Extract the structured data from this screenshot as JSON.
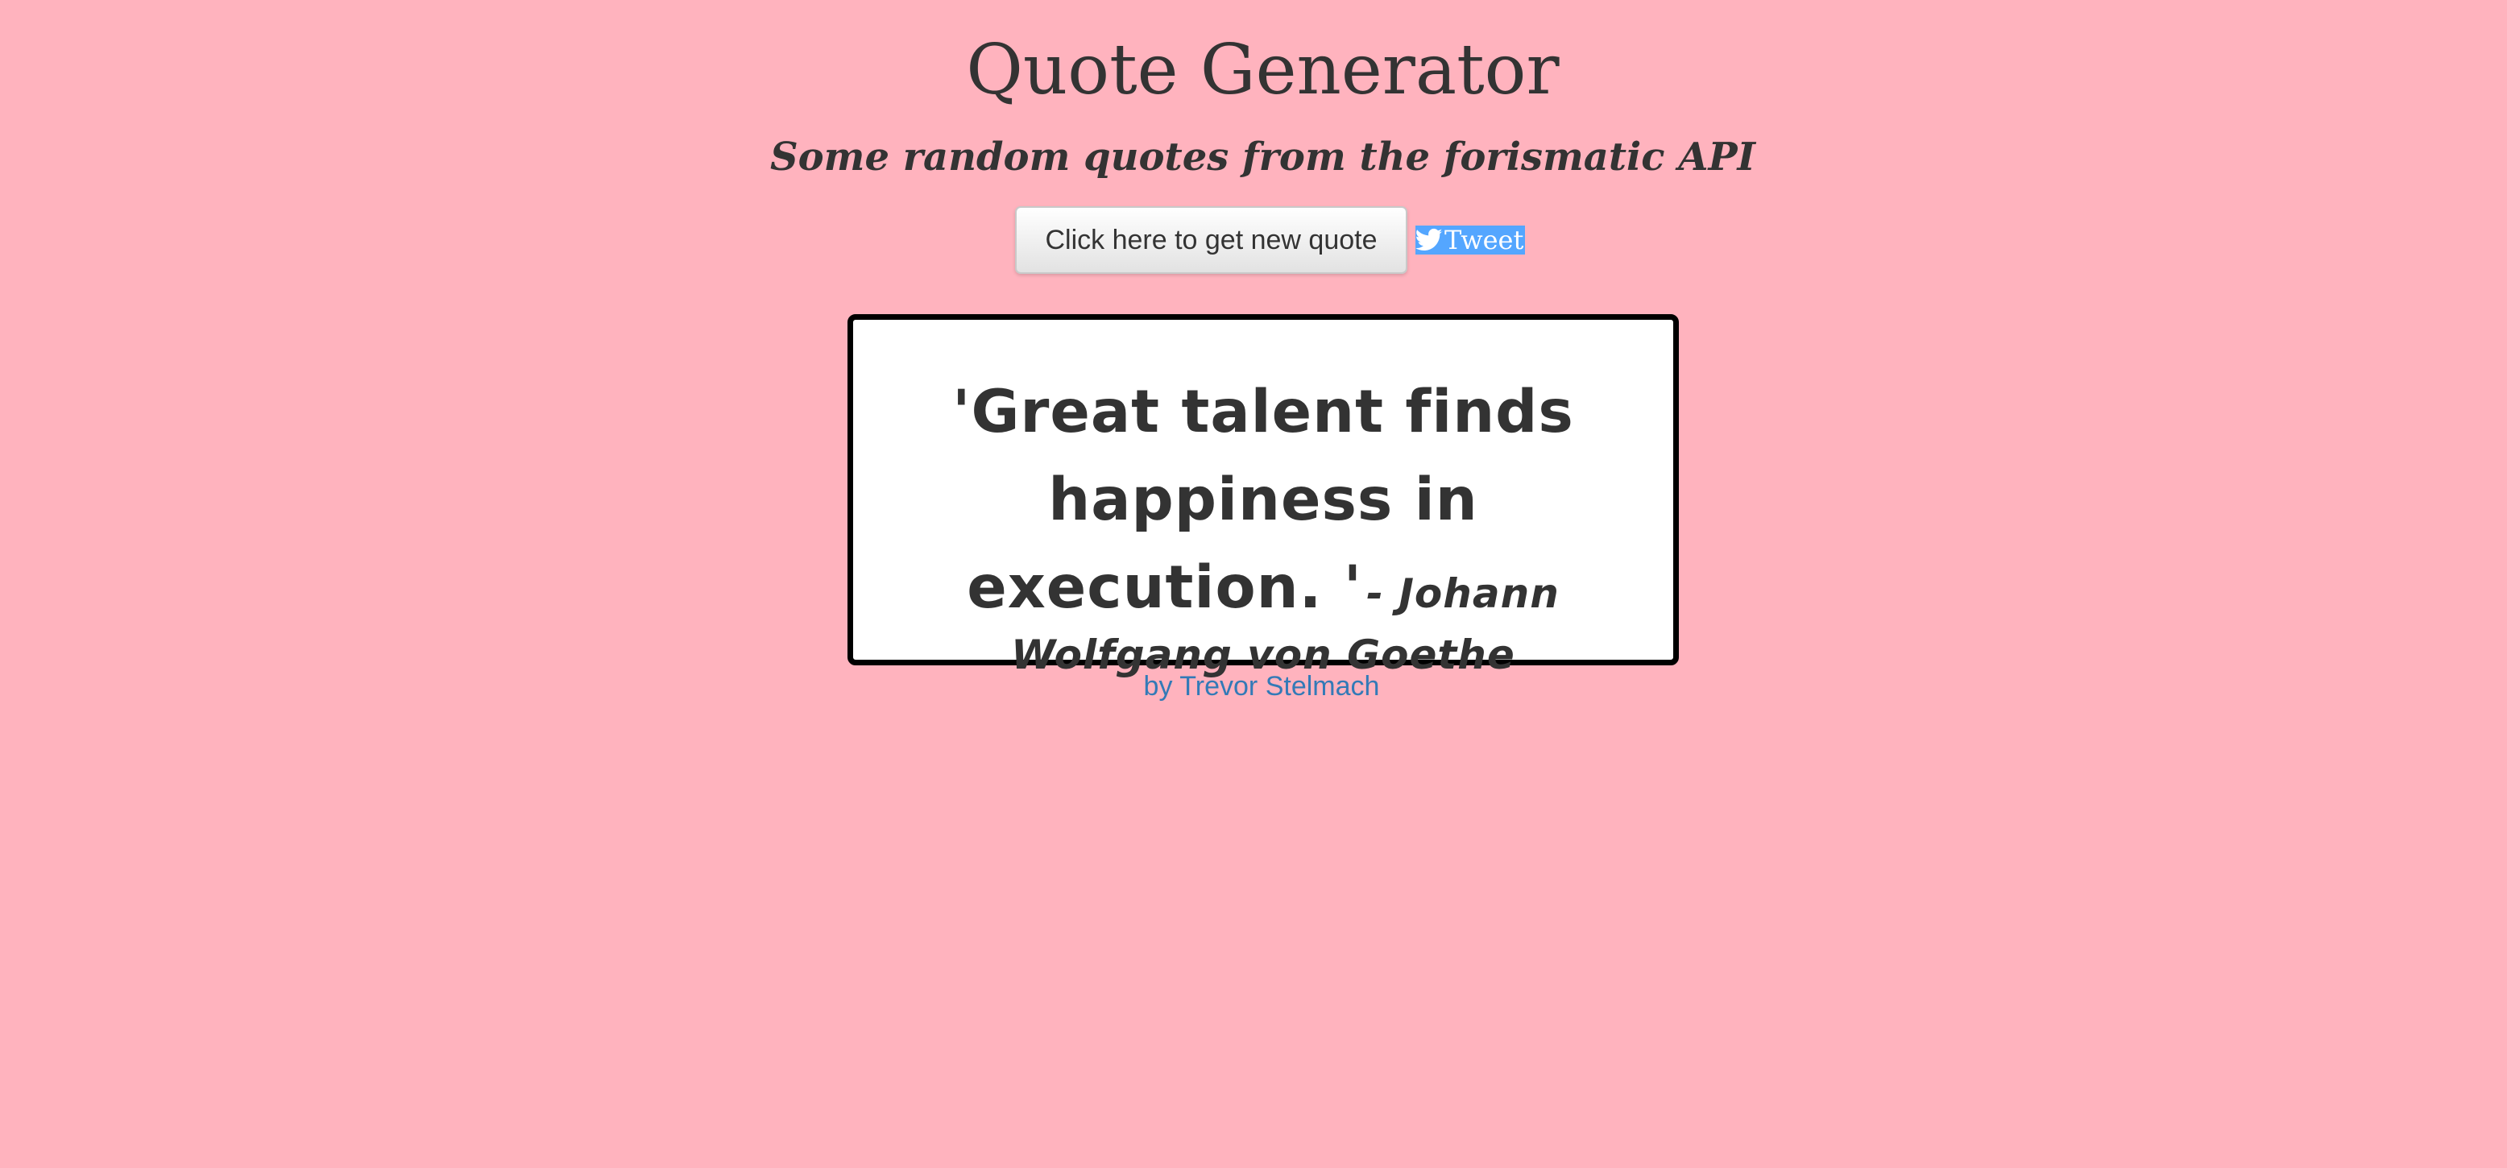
{
  "header": {
    "title": "Quote Generator",
    "subtitle": "Some random quotes from the forismatic API"
  },
  "actions": {
    "new_quote_label": "Click here to get new quote",
    "tweet_label": "Tweet",
    "tweet_icon": "twitter-icon"
  },
  "quote": {
    "text": "'Great talent finds happiness in execution. '",
    "author": "- Johann Wolfgang von Goethe"
  },
  "footer": {
    "credit": "by Trevor Stelmach"
  },
  "colors": {
    "page_background": "#ffb3be",
    "text": "#333333",
    "tweet_background": "#54a6ff",
    "link": "#337ab7",
    "card_border": "#000000"
  }
}
